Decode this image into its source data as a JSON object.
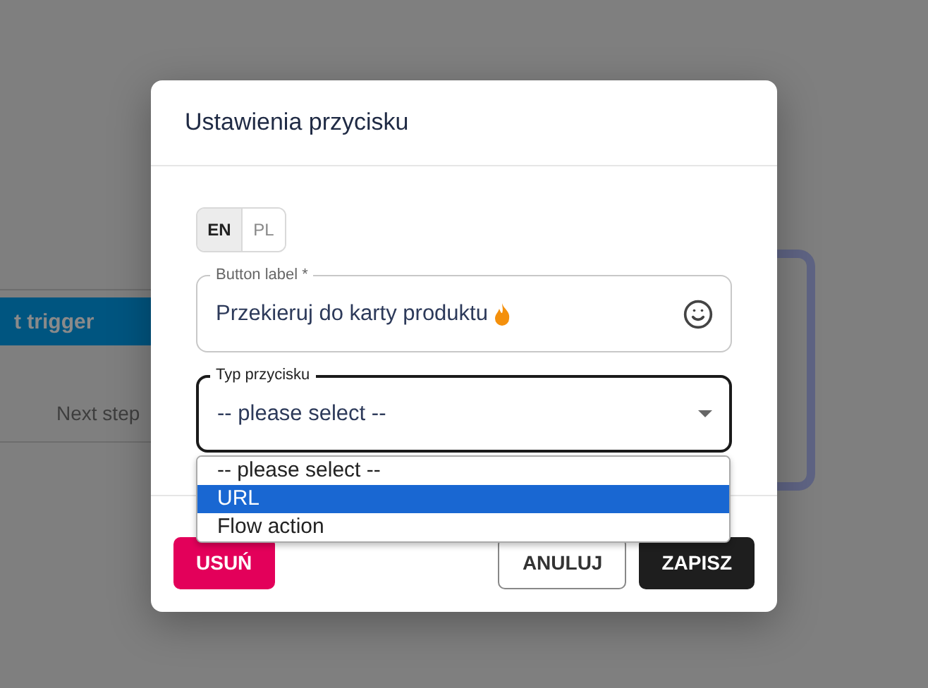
{
  "background": {
    "trigger_button": {
      "label": "t trigger"
    },
    "next_step": {
      "label": "Next step"
    }
  },
  "dialog": {
    "title": "Ustawienia przycisku",
    "languages": [
      {
        "label": "EN",
        "selected": true
      },
      {
        "label": "PL",
        "selected": false
      }
    ],
    "label_field": {
      "label": "Button label *",
      "value": "Przekieruj do karty produktu"
    },
    "type_field": {
      "label": "Typ przycisku",
      "value": "-- please select --",
      "expanded": true,
      "options": [
        {
          "label": "-- please select --",
          "highlighted": false
        },
        {
          "label": "URL",
          "highlighted": true
        },
        {
          "label": "Flow action",
          "highlighted": false
        }
      ]
    },
    "buttons": [
      {
        "label": "USUŃ",
        "kind": "danger"
      },
      {
        "label": "ANULUJ",
        "kind": "outline"
      },
      {
        "label": "ZAPISZ",
        "kind": "primary"
      }
    ]
  }
}
